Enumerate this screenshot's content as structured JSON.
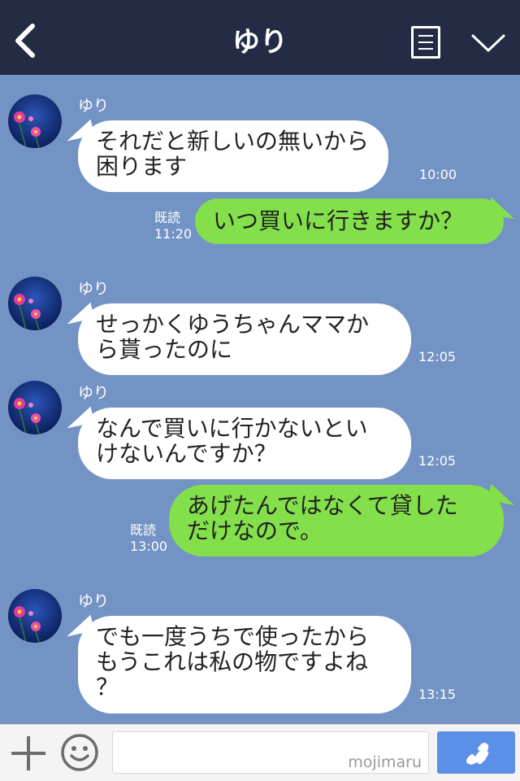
{
  "header": {
    "title": "ゆり"
  },
  "messages": [
    {
      "sender": "ゆり",
      "direction": "in",
      "lines": [
        "それだと新しいの無いから",
        "困ります"
      ],
      "time": "10:00"
    },
    {
      "direction": "out",
      "lines": [
        "いつ買いに行きますか？"
      ],
      "read": "既読",
      "time": "11:20"
    },
    {
      "sender": "ゆり",
      "direction": "in",
      "lines": [
        "せっかくゆうちゃんママか",
        "ら貰ったのに"
      ],
      "time": "12:05"
    },
    {
      "sender": "ゆり",
      "direction": "in",
      "lines": [
        "なんで買いに行かないとい",
        "けないんですか？"
      ],
      "time": "12:05"
    },
    {
      "direction": "out",
      "lines": [
        "あげたんではなくて貸した",
        "だけなので。"
      ],
      "read": "既読",
      "time": "13:00"
    },
    {
      "sender": "ゆり",
      "direction": "in",
      "lines": [
        "でも一度うちで使ったから",
        "もうこれは私の物ですよね",
        "？"
      ],
      "time": "13:15"
    }
  ],
  "footer": {
    "watermark": "mojimaru"
  },
  "colors": {
    "header_bg": "#242c45",
    "chat_bg": "#7393c4",
    "outgoing_bubble": "#83e04b",
    "incoming_bubble": "#ffffff",
    "call_button": "#5c8fe8"
  },
  "icons": {
    "back": "chevron-left-icon",
    "menu": "list-icon",
    "collapse": "chevron-down-icon",
    "attach": "plus-icon",
    "emoji": "smiley-icon",
    "call": "phone-icon"
  }
}
